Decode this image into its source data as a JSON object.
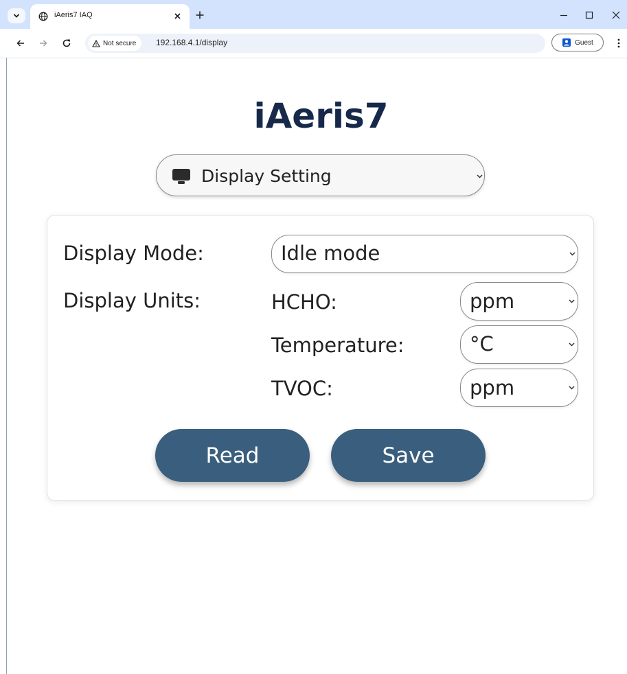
{
  "browser": {
    "tab": {
      "title": "iAeris7 IAQ"
    },
    "address_bar": {
      "security_label": "Not secure",
      "url": "192.168.4.1/display"
    },
    "profile": {
      "label": "Guest"
    }
  },
  "page": {
    "title": "iAeris7",
    "page_select": {
      "selected": "Display Setting",
      "icon": "monitor-icon"
    },
    "display_mode": {
      "label": "Display Mode:",
      "selected": "Idle mode"
    },
    "display_units": {
      "label": "Display Units:",
      "hcho": {
        "label": "HCHO:",
        "selected": "ppm"
      },
      "temperature": {
        "label": "Temperature:",
        "selected": "°C"
      },
      "tvoc": {
        "label": "TVOC:",
        "selected": "ppm"
      }
    },
    "buttons": {
      "read": "Read",
      "save": "Save"
    }
  },
  "colors": {
    "title": "#16294a",
    "button": "#3a5f7e",
    "tab_strip": "#d3e3fd",
    "omnibox": "#edf2fa"
  }
}
